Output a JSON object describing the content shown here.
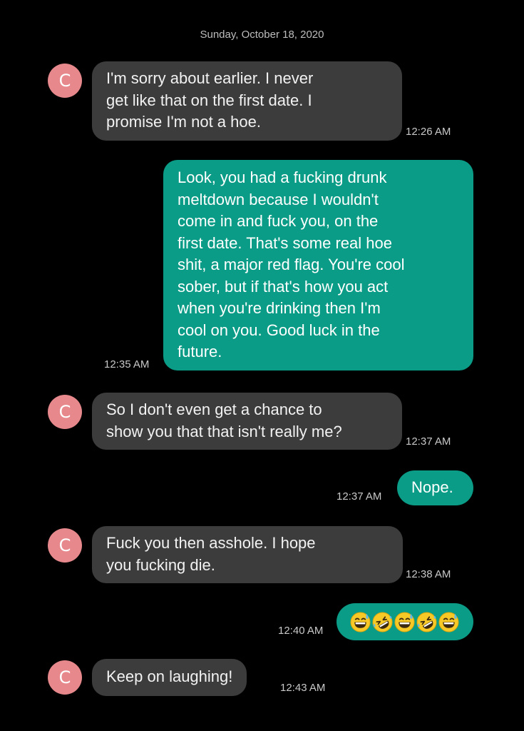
{
  "date_header": "Sunday, October 18, 2020",
  "contact_initial": "C",
  "colors": {
    "background": "#000000",
    "incoming_bubble": "#3c3c3c",
    "outgoing_bubble": "#0a9c86",
    "avatar": "#e7898c"
  },
  "messages": [
    {
      "direction": "incoming",
      "lines": [
        "I'm sorry about earlier.  I never",
        "get like that on the first date.  I",
        "promise I'm not a hoe."
      ],
      "time": "12:26 AM"
    },
    {
      "direction": "outgoing",
      "lines": [
        "Look, you had a fucking drunk",
        "meltdown because I wouldn't",
        "come in and fuck you, on the",
        "first date.   That's  some real hoe",
        "shit, a major red flag.  You're cool",
        "sober, but if that's  how you act",
        "when you're  drinking then I'm",
        "cool on you.  Good luck in the",
        "future."
      ],
      "time": "12:35 AM"
    },
    {
      "direction": "incoming",
      "lines": [
        "So I don't even get a chance to",
        "show you that that isn't really me?"
      ],
      "time": "12:37 AM"
    },
    {
      "direction": "outgoing",
      "lines": [
        "Nope."
      ],
      "time": "12:37 AM"
    },
    {
      "direction": "incoming",
      "lines": [
        "Fuck you then asshole.  I hope",
        "you fucking die."
      ],
      "time": "12:38 AM"
    },
    {
      "direction": "outgoing",
      "emojis": [
        "grinning-sweat-emoji",
        "rofl-emoji",
        "grinning-sweat-emoji",
        "rofl-emoji",
        "grinning-sweat-emoji"
      ],
      "time": "12:40 AM"
    },
    {
      "direction": "incoming",
      "lines": [
        "Keep on laughing!"
      ],
      "time": "12:43 AM"
    }
  ]
}
